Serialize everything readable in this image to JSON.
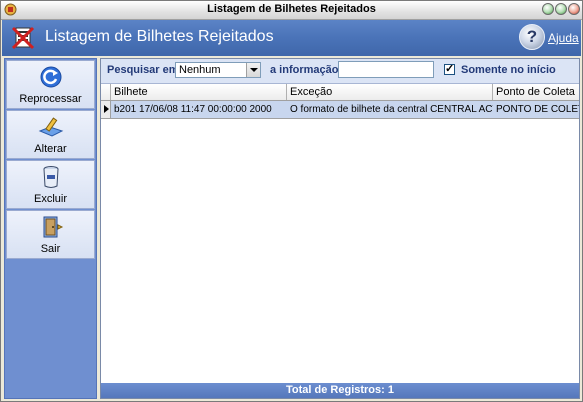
{
  "window": {
    "title": "Listagem de Bilhetes Rejeitados"
  },
  "header": {
    "title": "Listagem de Bilhetes Rejeitados",
    "help_label": "Ajuda",
    "help_glyph": "?"
  },
  "sidebar": {
    "items": [
      {
        "label": "Reprocessar",
        "icon": "reprocess-icon"
      },
      {
        "label": "Alterar",
        "icon": "edit-icon"
      },
      {
        "label": "Excluir",
        "icon": "trash-icon"
      },
      {
        "label": "Sair",
        "icon": "exit-door-icon"
      }
    ]
  },
  "filter": {
    "search_in_label": "Pesquisar em",
    "search_in_value": "Nenhum",
    "info_label": "a informação",
    "info_value": "",
    "only_start_label": "Somente no início",
    "only_start_checked": true
  },
  "grid": {
    "columns": [
      "Bilhete",
      "Exceção",
      "Ponto de Coleta"
    ],
    "rows": [
      {
        "bilhete": "b201   17/06/08 11:47 00:00:00 2000",
        "excecao": "O formato de bilhete da central CENTRAL ACTIVE",
        "ponto": "PONTO DE COLETA"
      }
    ]
  },
  "footer": {
    "text": "Total de Registros: 1"
  },
  "colors": {
    "header_blue": "#4a73b8",
    "sidebar_blue": "#6f8fd0",
    "selected_row": "#c8d6ee",
    "filter_label": "#233a78"
  }
}
